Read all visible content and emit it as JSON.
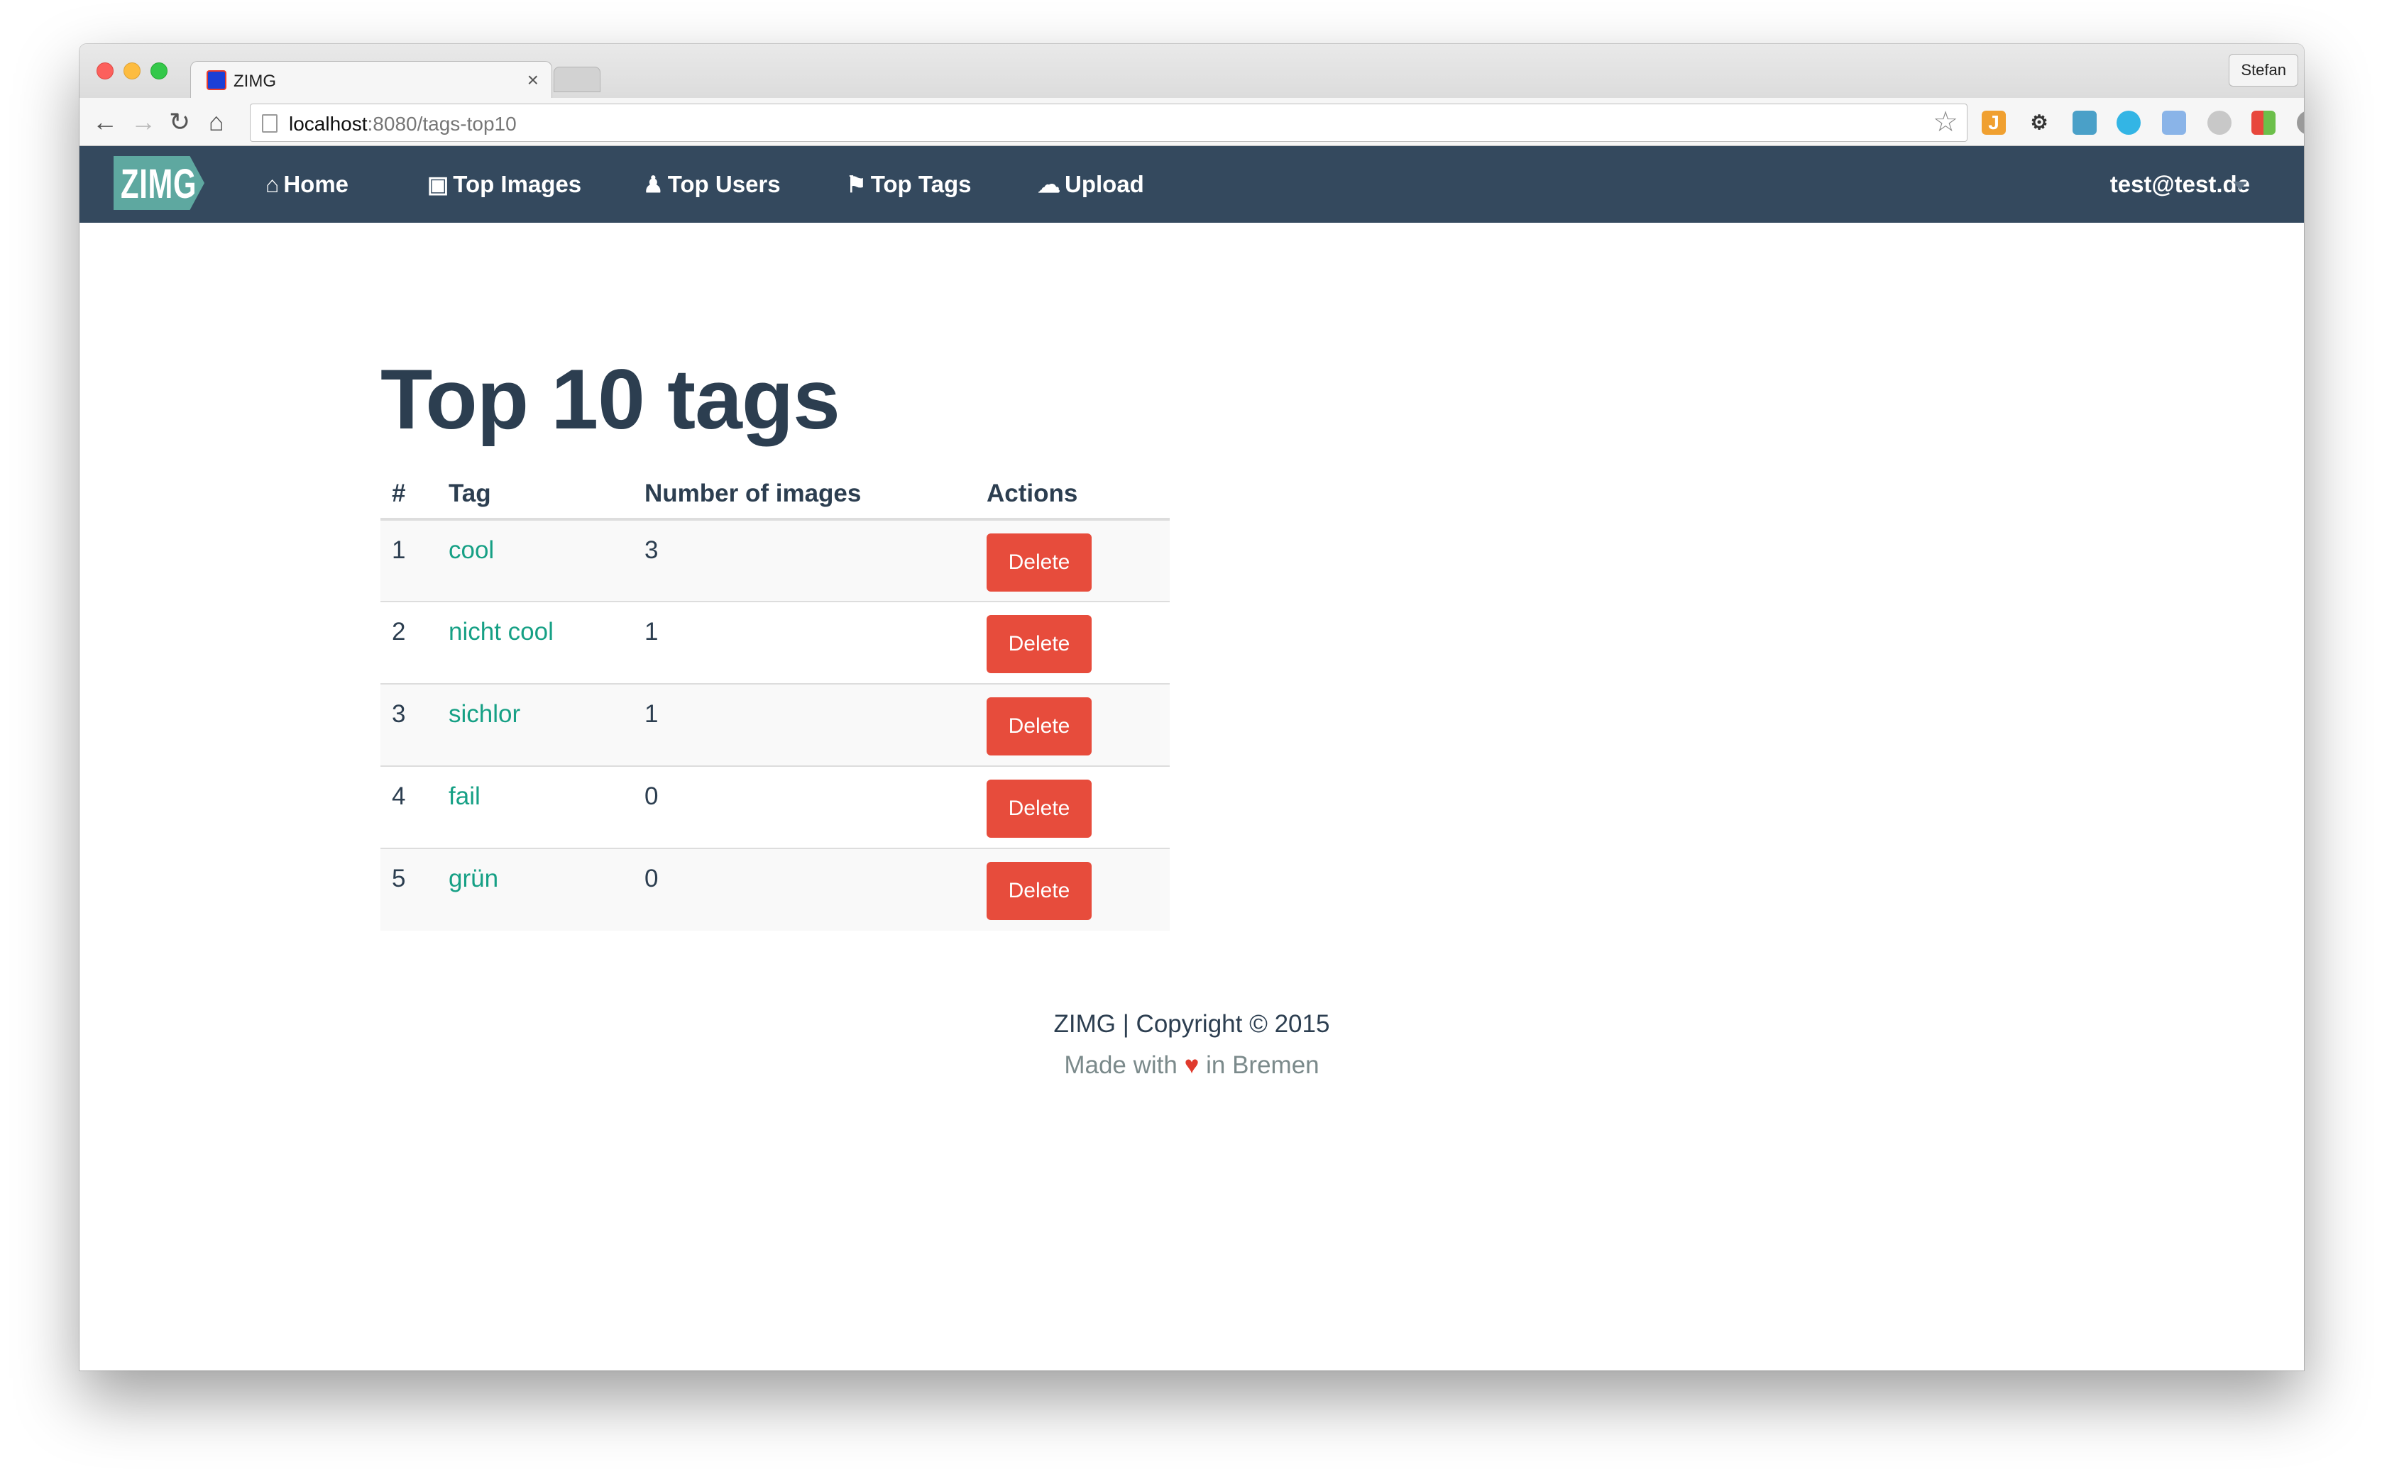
{
  "browser": {
    "tab_title": "ZIMG",
    "tab_close": "×",
    "profile_name": "Stefan",
    "url_host": "localhost",
    "url_path": ":8080/tags-top10",
    "icons": [
      "back-arrow-icon",
      "forward-arrow-icon",
      "reload-icon",
      "home-icon",
      "page-icon",
      "bookmark-star-icon",
      "settings-icon",
      "menu-icon"
    ]
  },
  "navbar": {
    "brand": "ZIMG",
    "items": [
      {
        "label": "Home",
        "icon": "home-icon"
      },
      {
        "label": "Top Images",
        "icon": "image-icon"
      },
      {
        "label": "Top Users",
        "icon": "user-icon"
      },
      {
        "label": "Top Tags",
        "icon": "tags-icon"
      },
      {
        "label": "Upload",
        "icon": "upload-cloud-icon"
      }
    ],
    "user": "test@test.de",
    "colors": {
      "background": "#34495e",
      "brand": "#5ea8a0"
    }
  },
  "page": {
    "title": "Top 10 tags"
  },
  "table": {
    "headers": {
      "num": "#",
      "tag": "Tag",
      "count": "Number of images",
      "actions": "Actions"
    },
    "rows": [
      {
        "num": "1",
        "tag": "cool",
        "count": "3",
        "action": "Delete"
      },
      {
        "num": "2",
        "tag": "nicht cool",
        "count": "1",
        "action": "Delete"
      },
      {
        "num": "3",
        "tag": "sichlor",
        "count": "1",
        "action": "Delete"
      },
      {
        "num": "4",
        "tag": "fail",
        "count": "0",
        "action": "Delete"
      },
      {
        "num": "5",
        "tag": "grün",
        "count": "0",
        "action": "Delete"
      }
    ],
    "colors": {
      "link": "#16a085",
      "delete_button": "#e74c3c"
    }
  },
  "footer": {
    "copyright": "ZIMG | Copyright © 2015",
    "made_with_prefix": "Made with",
    "heart": "♥",
    "made_with_suffix": "in Bremen"
  }
}
